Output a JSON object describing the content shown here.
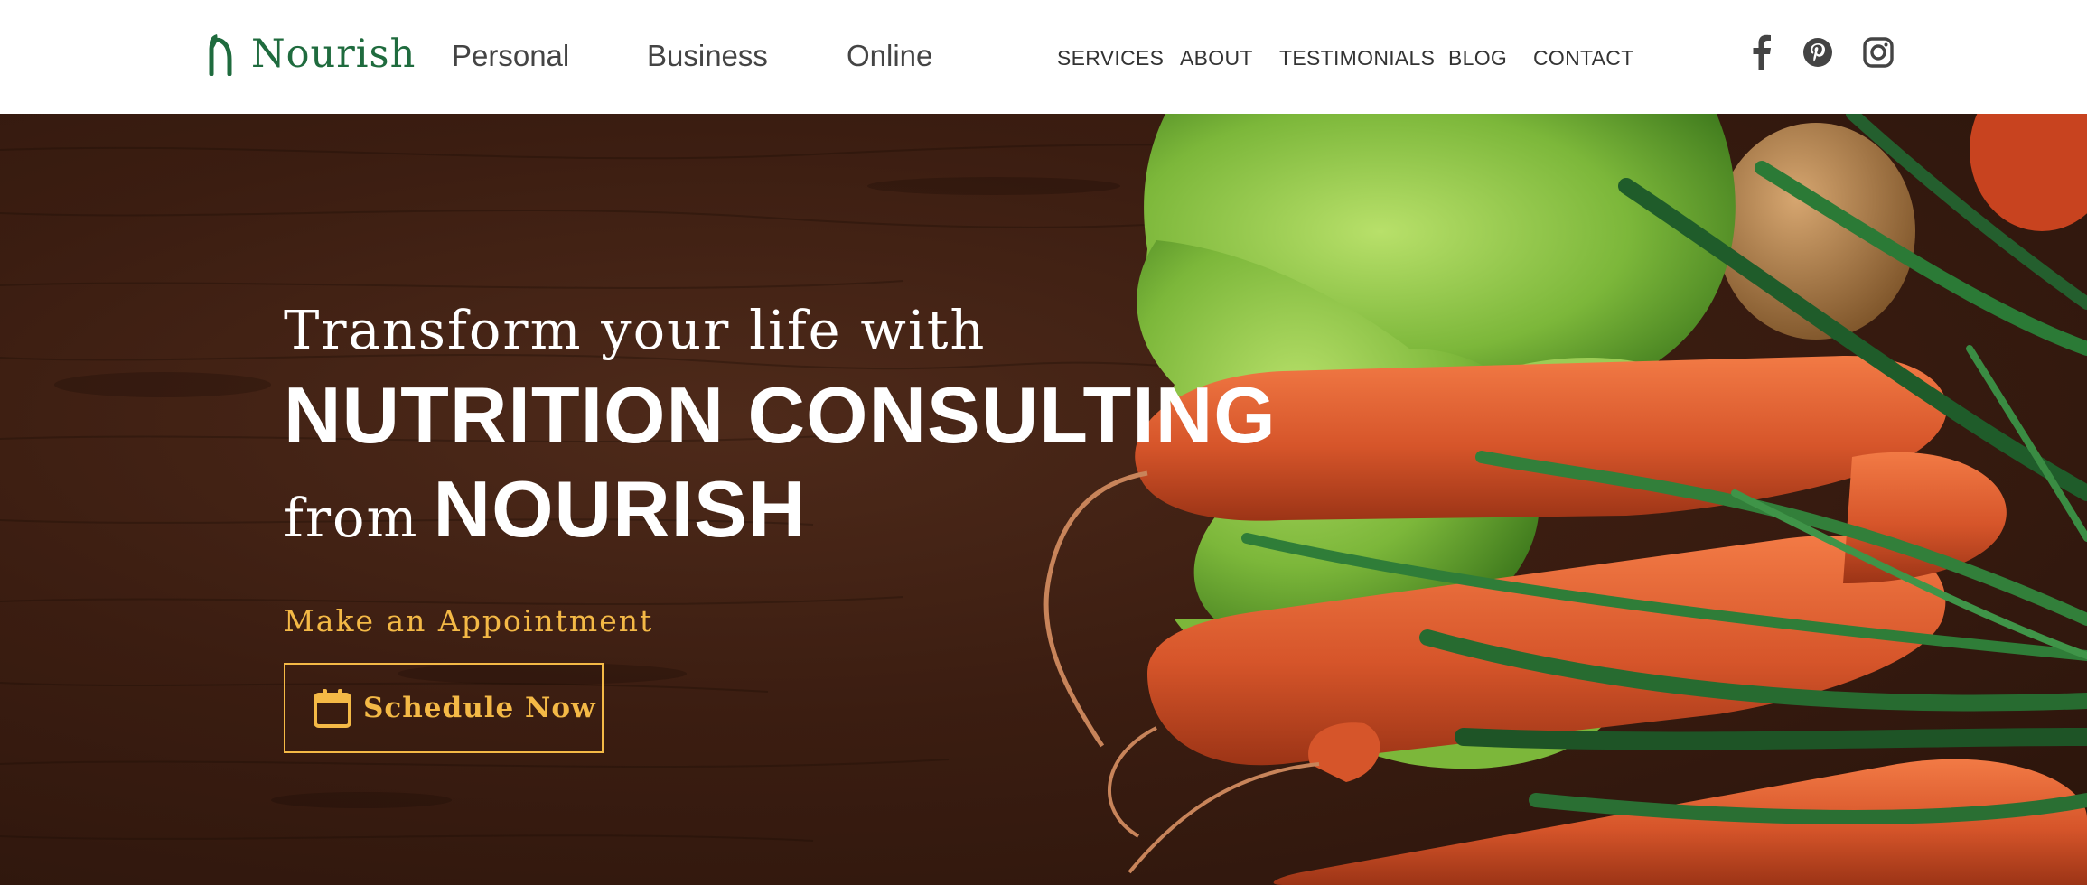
{
  "brand": {
    "name": "Nourish",
    "color": "#1f6b3e"
  },
  "primary_nav": [
    {
      "label": "Personal"
    },
    {
      "label": "Business"
    },
    {
      "label": "Online"
    }
  ],
  "secondary_nav": [
    {
      "label": "SERVICES"
    },
    {
      "label": "ABOUT"
    },
    {
      "label": "TESTIMONIALS"
    },
    {
      "label": "BLOG"
    },
    {
      "label": "CONTACT"
    }
  ],
  "social": [
    {
      "icon": "facebook-icon"
    },
    {
      "icon": "pinterest-icon"
    },
    {
      "icon": "instagram-icon"
    }
  ],
  "hero": {
    "lead": "Transform your life with",
    "headline": "NUTRITION CONSULTING",
    "from_word": "from",
    "brand_word": "NOURISH",
    "appointment_label": "Make an Appointment",
    "button_label": "Schedule Now",
    "button_icon": "calendar-icon",
    "accent_color": "#f4b946",
    "background_image": "wooden table with carrots, lettuce, green onions and potatoes"
  }
}
